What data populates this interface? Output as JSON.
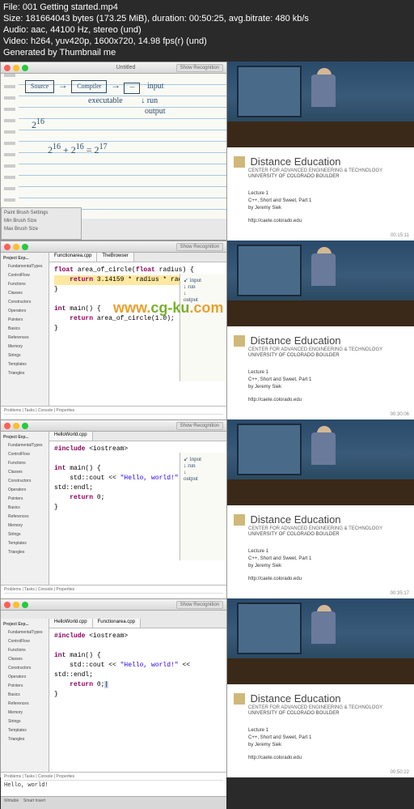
{
  "header": {
    "file": "File: 001 Getting started.mp4",
    "size": "Size: 181664043 bytes (173.25 MiB), duration: 00:50:25, avg.bitrate: 480 kb/s",
    "audio": "Audio: aac, 44100 Hz, stereo (und)",
    "video": "Video: h264, yuv420p, 1600x720, 14.98 fps(r) (und)",
    "generated": "Generated by Thumbnail me"
  },
  "mac": {
    "title1": "Untitled",
    "show_recog": "Show Recognition"
  },
  "notebook": {
    "source": "Source",
    "compiler": "Compiler",
    "input": "input",
    "run": "run",
    "executable": "executable",
    "output": "output",
    "exp1": "2^16",
    "exp2": "2^16 + 2^16 = 2^17",
    "brush_title": "Paint Brush Settings",
    "brush_min": "Min Brush Size",
    "brush_max": "Max Brush Size"
  },
  "eclipse": {
    "project_explorer": "Project Exp...",
    "items": [
      "FundamentalTypes",
      "ControlFlow",
      "Functions",
      "Classes",
      "Constructors",
      "Operators",
      "Pointers",
      "Basics",
      "References",
      "Memory",
      "Strings",
      "Templates",
      "Triangles"
    ],
    "tab1": "Functionarea.cpp",
    "tab2": "TheBrowser",
    "code_area1": "float area_of_circle(float radius) {",
    "code_area2": "    return 3.14159 * radius * radius;",
    "code_area3": "}",
    "code_main1": "int main() {",
    "code_main2": "    return area_of_circle(1.0);",
    "code_main3": "}",
    "console_tabs": "Problems | Tasks | Console | Properties",
    "bottom1": "Writable",
    "bottom2": "Smart Insert"
  },
  "hello": {
    "include": "#include <iostream>",
    "main1": "int main() {",
    "cout": "    std::cout << \"Hello, world!\" << std::endl;",
    "ret": "    return 0;",
    "close": "}",
    "output": "Hello, world!",
    "tab": "HelloWorld.cpp"
  },
  "distance_ed": {
    "title": "Distance Education",
    "subtitle": "CENTER FOR ADVANCED ENGINEERING & TECHNOLOGY",
    "university": "UNIVERSITY OF COLORADO BOULDER",
    "lecture": "Lecture 1",
    "course": "C++, Short and Sweet, Part 1",
    "instructor": "by Jeremy Siek",
    "url": "http://caete.colorado.edu",
    "ts1": "00:15:11",
    "ts2": "00:30:06",
    "ts3": "00:35:17",
    "ts4": "00:50:22"
  },
  "watermark": {
    "p1": "www.",
    "p2": "cg-ku",
    "p3": ".com"
  }
}
